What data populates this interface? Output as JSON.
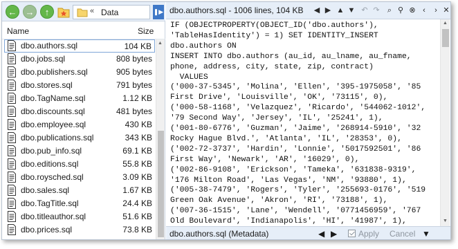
{
  "colors": {
    "accent": "#3f78c7",
    "toolbar_bg": "#e6eef8",
    "nav_green": "#64b74a",
    "selection_border": "#7fa6d8"
  },
  "left_toolbar": {
    "back_icon": "arrow-left-icon",
    "forward_icon": "arrow-right-icon",
    "up_icon": "arrow-up-icon",
    "favorites_icon": "star-folder-icon",
    "path_separator": "«",
    "path": "Data",
    "collapse_icon": "chevron-left-icon"
  },
  "columns": {
    "name": "Name",
    "size": "Size"
  },
  "files": [
    {
      "name": "dbo.authors.sql",
      "size": "104 KB",
      "selected": true
    },
    {
      "name": "dbo.jobs.sql",
      "size": "808 bytes"
    },
    {
      "name": "dbo.publishers.sql",
      "size": "905 bytes"
    },
    {
      "name": "dbo.stores.sql",
      "size": "791 bytes"
    },
    {
      "name": "dbo.TagName.sql",
      "size": "1.12 KB"
    },
    {
      "name": "dbo.discounts.sql",
      "size": "481 bytes"
    },
    {
      "name": "dbo.employee.sql",
      "size": "430 KB"
    },
    {
      "name": "dbo.publications.sql",
      "size": "343 KB"
    },
    {
      "name": "dbo.pub_info.sql",
      "size": "69.1 KB"
    },
    {
      "name": "dbo.editions.sql",
      "size": "55.8 KB"
    },
    {
      "name": "dbo.roysched.sql",
      "size": "3.09 KB"
    },
    {
      "name": "dbo.sales.sql",
      "size": "1.67 KB"
    },
    {
      "name": "dbo.TagTitle.sql",
      "size": "24.4 KB"
    },
    {
      "name": "dbo.titleauthor.sql",
      "size": "51.6 KB"
    },
    {
      "name": "dbo.prices.sql",
      "size": "73.8 KB"
    }
  ],
  "viewer": {
    "title": "dbo.authors.sql - 1006 lines, 104 KB",
    "toolbar_icons": [
      "back-icon",
      "forward-icon",
      "up-icon",
      "down-icon",
      "undo-icon",
      "redo-icon",
      "find-next-icon",
      "find-icon",
      "clear-find-icon",
      "previous-icon",
      "next-icon",
      "close-icon"
    ],
    "toolbar_glyphs": [
      "◀",
      "▶",
      "▲",
      "▼",
      "↶",
      "↷",
      "⌕",
      "⚲",
      "⊗",
      "‹",
      "›",
      "✕"
    ],
    "code_lines": [
      "IF (OBJECTPROPERTY(OBJECT_ID('dbo.authors'),",
      "'TableHasIdentity') = 1) SET IDENTITY_INSERT",
      "dbo.authors ON",
      "INSERT INTO dbo.authors (au_id, au_lname, au_fname,",
      "phone, address, city, state, zip, contract)",
      "  VALUES",
      "('000-37-5345', 'Molina', 'Ellen', '395-1975058', '85",
      "First Drive', 'Louisville', 'OK', '73115', 0),",
      "('000-58-1168', 'Velazquez', 'Ricardo', '544062-1012',",
      "'79 Second Way', 'Jersey', 'IL', '25241', 1),",
      "('001-80-6776', 'Guzman', 'Jaime', '268914-5910', '32",
      "Rocky Hague Blvd.', 'Atlanta', 'IL', '28353', 0),",
      "('002-72-3737', 'Hardin', 'Lonnie', '5017592501', '86",
      "First Way', 'Newark', 'AR', '16029', 0),",
      "('002-86-9108', 'Erickson', 'Tameka', '631838-9319',",
      "'176 Milton Road', 'Las Vegas', 'NM', '93880', 1),",
      "('005-38-7479', 'Rogers', 'Tyler', '255693-0176', '519",
      "Green Oak Avenue', 'Akron', 'RI', '73188', 1),",
      "('007-36-1515', 'Lane', 'Wendell', '0771456959', '767",
      "Old Boulevard', 'Indianapolis', 'HI', '41987', 1),"
    ]
  },
  "status": {
    "text": "dbo.authors.sql (Metadata)",
    "prev_icon": "previous-icon",
    "next_icon": "next-icon",
    "apply_label": "Apply",
    "cancel_label": "Cancel",
    "more_icon": "more-icon"
  }
}
